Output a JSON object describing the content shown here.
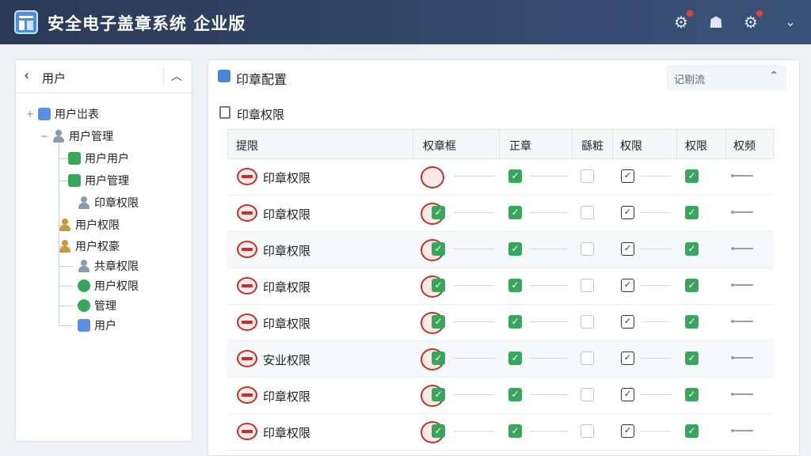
{
  "app": {
    "title": "安全电子盖章系统  企业版"
  },
  "topbar": {
    "icons": [
      "gear-badge-icon",
      "user-hat-icon",
      "settings-icon",
      "chevron-down-icon"
    ]
  },
  "left_panel": {
    "title": "用户",
    "tree": [
      {
        "label": "用户岀表",
        "icon": "list-icon",
        "toggle": "+"
      },
      {
        "label": "用户管理",
        "icon": "person-icon",
        "toggle": "−"
      },
      {
        "label": "用户用户",
        "icon": "green-app-icon"
      },
      {
        "label": "用户管理",
        "icon": "green-app-icon"
      },
      {
        "label": "印章权限",
        "icon": "person-icon"
      },
      {
        "label": "用户权限",
        "icon": "person-gold-icon"
      },
      {
        "label": "用户权豪",
        "icon": "person-gold-icon"
      },
      {
        "label": "共章权限",
        "icon": "person-icon"
      },
      {
        "label": "用户权限",
        "icon": "green-check-icon"
      },
      {
        "label": "管理",
        "icon": "green-check-icon"
      },
      {
        "label": "用户",
        "icon": "star-icon"
      }
    ]
  },
  "main": {
    "title": "印章配置",
    "select_value": "记剔流",
    "section_title": "印章权限",
    "columns": [
      "提限",
      "权章框",
      "正章",
      "繇粧",
      "权限",
      "权限",
      "权频"
    ],
    "rows": [
      {
        "name": "印章权限",
        "c1": true,
        "c2": true,
        "c3": false,
        "c4": true,
        "c5": true,
        "seal_check": false
      },
      {
        "name": "印章权限",
        "c1": true,
        "c2": true,
        "c3": false,
        "c4": true,
        "c5": true,
        "seal_check": true
      },
      {
        "name": "印章权限",
        "c1": true,
        "c2": true,
        "c3": false,
        "c4": true,
        "c5": true,
        "seal_check": true
      },
      {
        "name": "印章权限",
        "c1": true,
        "c2": true,
        "c3": false,
        "c4": true,
        "c5": true,
        "seal_check": true
      },
      {
        "name": "印章权限",
        "c1": true,
        "c2": true,
        "c3": false,
        "c4": true,
        "c5": true,
        "seal_check": true
      },
      {
        "name": "安业权限",
        "c1": true,
        "c2": true,
        "c3": false,
        "c4": true,
        "c5": true,
        "seal_check": true
      },
      {
        "name": "印章权限",
        "c1": true,
        "c2": true,
        "c3": false,
        "c4": true,
        "c5": true,
        "seal_check": true
      },
      {
        "name": "印章权限",
        "c1": true,
        "c2": true,
        "c3": false,
        "c4": true,
        "c5": true,
        "seal_check": true
      }
    ]
  }
}
